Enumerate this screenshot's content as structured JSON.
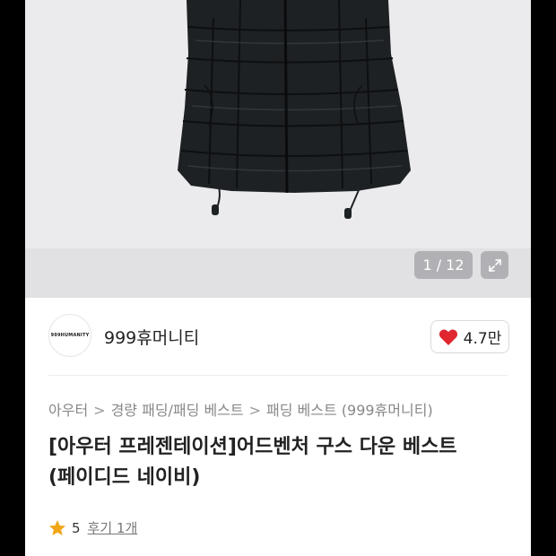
{
  "gallery": {
    "counter": "1 / 12",
    "icons": {
      "expand": "expand-icon"
    }
  },
  "seller": {
    "logo_text": "999HUMANITY",
    "name": "999휴머니티"
  },
  "like": {
    "icon": "heart-icon",
    "count": "4.7만",
    "color": "#e0262f"
  },
  "breadcrumb": {
    "items": [
      "아우터",
      "경량 패딩/패딩 베스트",
      "패딩 베스트 (999휴머니티)"
    ],
    "separator": ">"
  },
  "product": {
    "title_line1": "[아우터 프레젠테이션]어드벤처 구스 다운 베스트",
    "title_line2": "(페이디드 네이비)"
  },
  "rating": {
    "icon": "star-icon",
    "value": "5",
    "review_link": "후기 1개",
    "star_color": "#f2a516"
  }
}
